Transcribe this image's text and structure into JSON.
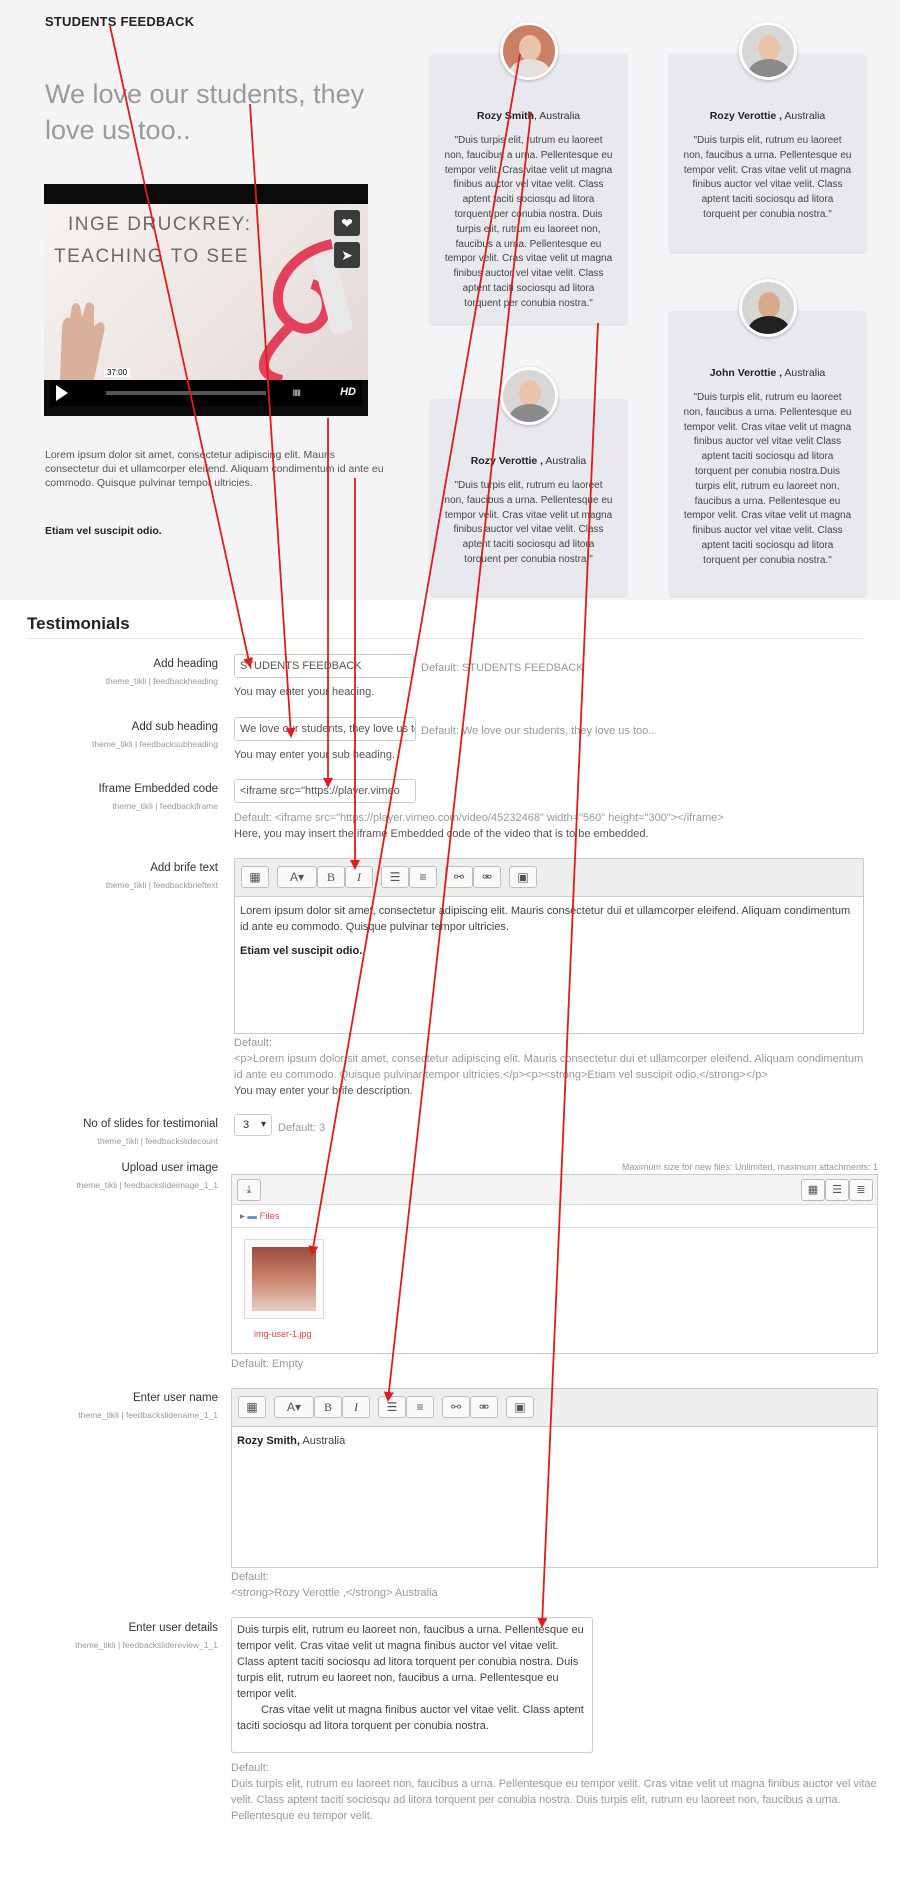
{
  "preview": {
    "heading": "STUDENTS FEEDBACK",
    "subheading": "We love our students, they love us too..",
    "video": {
      "title_line1": "INGE DRUCKREY:",
      "title_line2": "TEACHING TO SEE",
      "time": "37:00",
      "hd_label": "HD",
      "bars_label": "IIIII"
    },
    "body_text": "Lorem ipsum dolor sit amet, consectetur adipiscing elit. Mauris consectetur dui et ullamcorper eleifend. Aliquam condimentum id ante eu commodo. Quisque pulvinar tempor ultricies.",
    "bold_text": "Etiam vel suscipit odio.",
    "cards": [
      {
        "name": "Rozy Smith",
        "country": ", Australia",
        "quote": "\"Duis turpis elit, rutrum eu laoreet non, faucibus a urna. Pellentesque eu tempor velit. Cras vitae velit ut magna finibus auctor vel vitae velit. Class aptent taciti sociosqu ad litora torquent per conubia nostra. Duis turpis elit, rutrum eu laoreet non, faucibus a urna. Pellentesque eu tempor velit. Cras vitae velit ut magna finibus auctor vel vitae velit. Class aptent taciti sociosqu ad litora torquent per conubia nostra.\""
      },
      {
        "name": "Rozy Verottie ,",
        "country": " Australia",
        "quote": "\"Duis turpis elit, rutrum eu laoreet non, faucibus a urna. Pellentesque eu tempor velit. Cras vitae velit ut magna finibus auctor vel vitae velit. Class aptent taciti sociosqu ad litora torquent per conubia nostra.\""
      },
      {
        "name": "John Verottie ,",
        "country": " Australia",
        "quote": "\"Duis turpis elit, rutrum eu laoreet non, faucibus a urna. Pellentesque eu tempor velit. Cras vitae velit ut magna finibus auctor vel vitae velit Class aptent taciti sociosqu ad litora torquent per conubia nostra.Duis turpis elit, rutrum eu laoreet non, faucibus a urna. Pellentesque eu tempor velit. Cras vitae velit ut magna finibus auctor vel vitae velit. Class aptent taciti sociosqu ad litora torquent per conubia nostra.\""
      },
      {
        "name": "Rozy Verottie ,",
        "country": " Australia",
        "quote": "\"Duis turpis elit, rutrum eu laoreet non, faucibus a urna. Pellentesque eu tempor velit. Cras vitae velit ut magna finibus auctor vel vitae velit. Class aptent taciti sociosqu ad litora torquent per conubia nostra.\""
      }
    ]
  },
  "section_title": "Testimonials",
  "fields": {
    "heading": {
      "label": "Add heading",
      "meta": "theme_tikli | feedbackheading",
      "value": "STUDENTS FEEDBACK",
      "default": "Default: STUDENTS FEEDBACK",
      "note": "You may enter your heading."
    },
    "subheading": {
      "label": "Add sub heading",
      "meta": "theme_tikli | feedbacksubheading",
      "value": "We love our students, they love us too..",
      "default": "Default: We love our students, they love us too..",
      "note": "You may enter your sub heading."
    },
    "iframe": {
      "label": "Iframe Embedded code",
      "meta": "theme_tikli | feedbackiframe",
      "value": "<iframe src=\"https://player.vimeo",
      "default": "Default: <iframe src=\"https://player.vimeo.com/video/45232468\" width=\"560\" height=\"300\"></iframe>",
      "note": "Here, you may insert the iframe Embedded code of the video that is to be embedded."
    },
    "brief": {
      "label": "Add brife text",
      "meta": "theme_tikli | feedbackbrieftext",
      "content_line1": "Lorem ipsum dolor sit amet, consectetur adipiscing elit. Mauris consectetur dui et ullamcorper eleifend. Aliquam condimentum id ante eu commodo. Quisque pulvinar tempor ultricies.",
      "content_bold": "Etiam vel suscipit odio.",
      "default_label": "Default:",
      "default_value": "<p>Lorem ipsum dolor sit amet, consectetur adipiscing elit. Mauris consectetur dui et ullamcorper eleifend. Aliquam condimentum id ante eu commodo. Quisque pulvinar tempor ultricies.</p><p><strong>Etiam vel suscipit odio.</strong></p>",
      "note": "You may enter your brife description."
    },
    "slides": {
      "label": "No of slides for testimonial",
      "meta": "theme_tikli | feedbackslidecount",
      "value": "3",
      "default": "Default: 3"
    },
    "upload": {
      "label": "Upload user image",
      "meta": "theme_tikli | feedbackslideimage_1_1",
      "max_size": "Maximum size for new files: Unlimited, maximum attachments: 1",
      "folder": "Files",
      "file_name": "img-user-1.jpg",
      "default": "Default: Empty"
    },
    "username": {
      "label": "Enter user name",
      "meta": "theme_tikli | feedbackslidename_1_1",
      "content_bold": "Rozy Smith,",
      "content_rest": " Australia",
      "default_label": "Default:",
      "default_value": "<strong>Rozy Verottie ,</strong> Australia"
    },
    "details": {
      "label": "Enter user details",
      "meta": "theme_tikli | feedbackslidereview_1_1",
      "content": "Duis turpis elit, rutrum eu laoreet non, faucibus a urna. Pellentesque eu tempor velit. Cras vitae velit ut magna finibus auctor vel vitae velit. Class aptent taciti sociosqu ad litora torquent per conubia nostra. Duis turpis elit, rutrum eu laoreet non, faucibus a urna. Pellentesque eu tempor velit.",
      "content2": "Cras vitae velit ut magna finibus auctor vel vitae velit. Class aptent taciti sociosqu ad litora torquent per conubia nostra.",
      "default_label": "Default:",
      "default_value": "Duis turpis elit, rutrum eu laoreet non, faucibus a urna. Pellentesque eu tempor velit. Cras vitae velit ut magna finibus auctor vel vitae velit. Class aptent taciti sociosqu ad litora torquent per conubia nostra. Duis turpis elit, rutrum eu laoreet non, faucibus a urna. Pellentesque eu tempor velit."
    }
  },
  "editor_toolbar": {
    "bold": "B",
    "italic": "I"
  },
  "colors": {
    "arrow": "#e01b1b",
    "link": "#e0464b",
    "card_bg": "#e8e9ee"
  }
}
